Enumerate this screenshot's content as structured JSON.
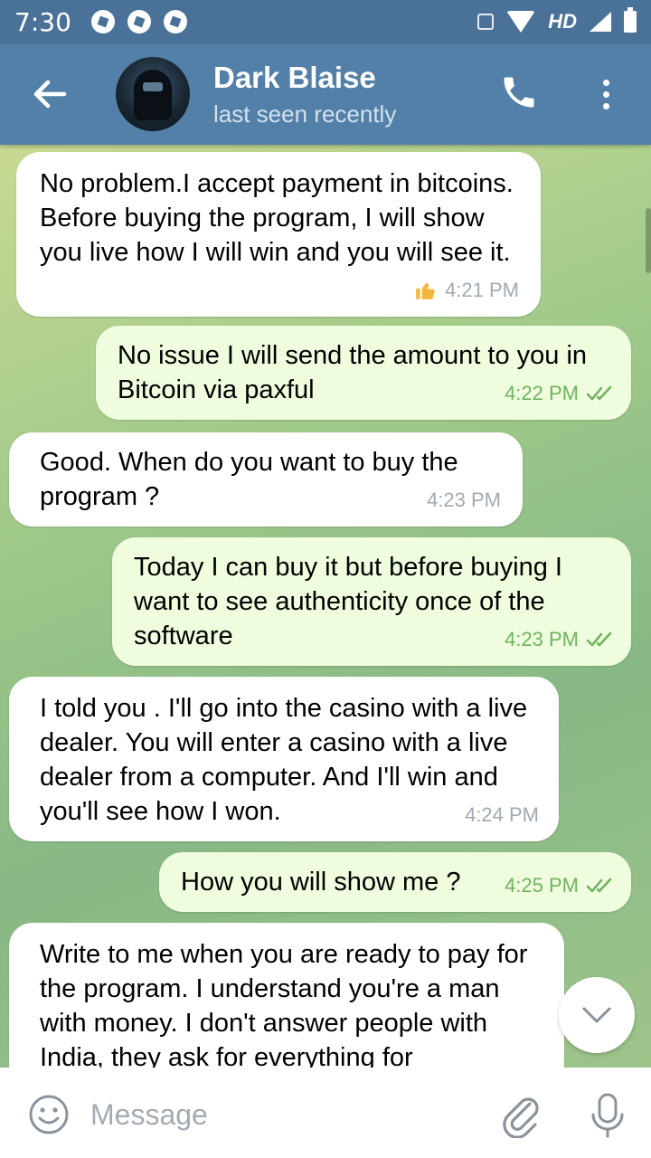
{
  "status_bar": {
    "time": "7:30",
    "network": "HD"
  },
  "header": {
    "contact_name": "Dark Blaise",
    "status": "last seen recently"
  },
  "messages": [
    {
      "direction": "in",
      "text": "No problem.I accept payment in bitcoins. Before buying the program, I will show you live how I will win and you will see it.",
      "time": "4:21 PM",
      "reaction": "thumbs-up"
    },
    {
      "direction": "out",
      "text": "No issue I will send the amount to you in Bitcoin via paxful",
      "time": "4:22 PM",
      "read": true
    },
    {
      "direction": "in",
      "text": "Good. When do you want to buy the program ?",
      "time": "4:23 PM"
    },
    {
      "direction": "out",
      "text": "Today I can buy it but before buying I want to see authenticity once of the software",
      "time": "4:23 PM",
      "read": true
    },
    {
      "direction": "in",
      "text": "I told you . I'll go into the casino with a live dealer. You will enter a casino with a live dealer from a computer. And I'll win and you'll see how I won.",
      "time": "4:24 PM"
    },
    {
      "direction": "out",
      "text": "How you will show me ?",
      "time": "4:25 PM",
      "read": true
    },
    {
      "direction": "in",
      "text": "Write to me when you are ready to pay for the program. I understand you're a man with money. I don't answer people with India, they ask for everything for",
      "time": ""
    }
  ],
  "composer": {
    "placeholder": "Message"
  },
  "colors": {
    "status_bar": "#4a7299",
    "header": "#5380a8",
    "outgoing_bubble": "#effdde",
    "incoming_bubble": "#ffffff",
    "outgoing_meta": "#6fb25e",
    "incoming_meta": "#a1aab3"
  }
}
